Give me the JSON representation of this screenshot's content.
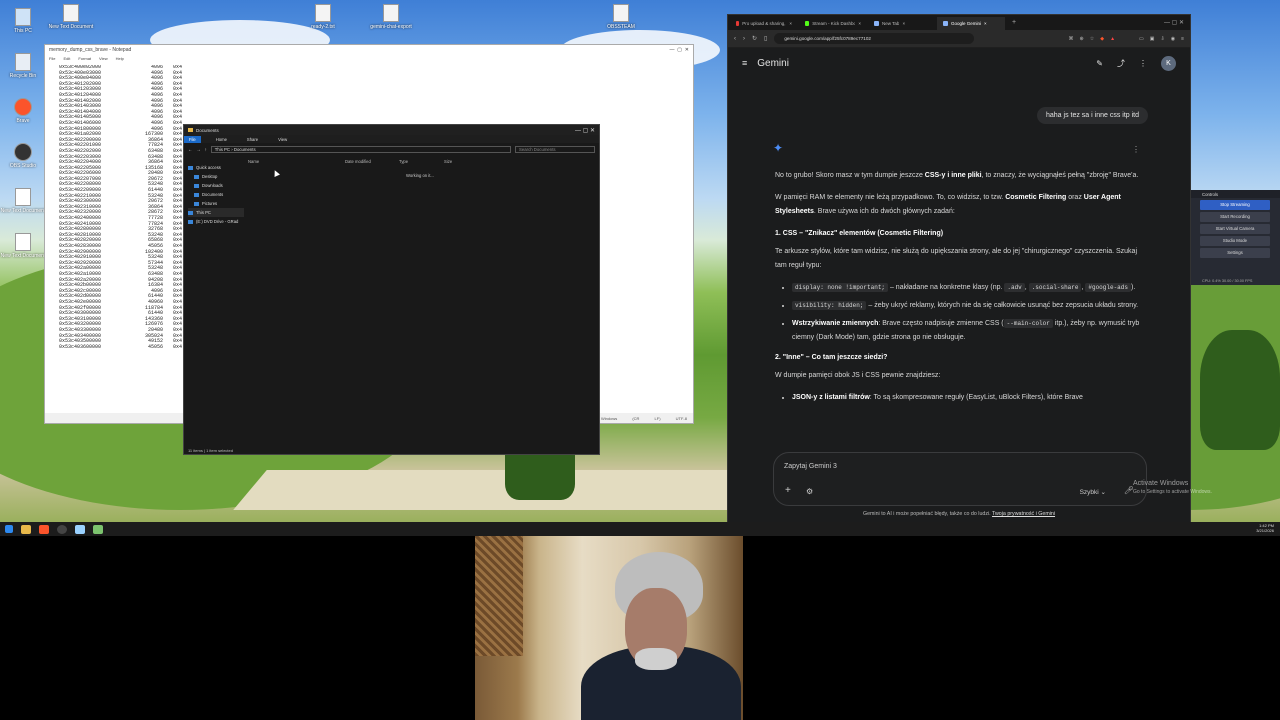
{
  "desktop": {
    "icons": [
      {
        "label": "This PC",
        "kind": "pc"
      },
      {
        "label": "Recycle Bin",
        "kind": "bin"
      },
      {
        "label": "Brave",
        "kind": "brave"
      },
      {
        "label": "OBS Studio",
        "kind": "obs"
      },
      {
        "label": "New Text Document",
        "kind": "doc"
      },
      {
        "label": "New Text Document",
        "kind": "doc"
      }
    ],
    "top_icons": [
      {
        "label": "New Text Document"
      },
      {
        "label": "ready-2.txt"
      },
      {
        "label": "gemini-chat-export"
      },
      {
        "label": "OBSSTEAM"
      }
    ]
  },
  "notepad": {
    "title": "memory_dump_css_brave - Notepad",
    "menu": [
      "File",
      "Edit",
      "Format",
      "View",
      "Help"
    ],
    "status": "Windows (CR LF)  UTF-8",
    "rows": [
      [
        "0x53c400e02000",
        "4096",
        "0x4"
      ],
      [
        "0x53c400e03000",
        "4096",
        "0x4"
      ],
      [
        "0x53c400e04000",
        "4096",
        "0x4"
      ],
      [
        "0x53c401202000",
        "4096",
        "0x4"
      ],
      [
        "0x53c401203000",
        "4096",
        "0x4"
      ],
      [
        "0x53c401204000",
        "4096",
        "0x4"
      ],
      [
        "0x53c401402000",
        "4096",
        "0x4"
      ],
      [
        "0x53c401403000",
        "4096",
        "0x4"
      ],
      [
        "0x53c401404000",
        "4096",
        "0x4"
      ],
      [
        "0x53c401405000",
        "4096",
        "0x4"
      ],
      [
        "0x53c401406000",
        "4096",
        "0x4"
      ],
      [
        "0x53c401800000",
        "4096",
        "0x4"
      ],
      [
        "0x53c401a02000",
        "167300",
        "0x4"
      ],
      [
        "0x53c402200000",
        "36864",
        "0x4"
      ],
      [
        "0x53c402201000",
        "77824",
        "0x4"
      ],
      [
        "0x53c402202000",
        "63488",
        "0x4"
      ],
      [
        "0x53c402203000",
        "63488",
        "0x4"
      ],
      [
        "0x53c402204000",
        "36864",
        "0x4"
      ],
      [
        "0x53c402205000",
        "135168",
        "0x4"
      ],
      [
        "0x53c402206000",
        "20480",
        "0x4"
      ],
      [
        "0x53c402207000",
        "20672",
        "0x4"
      ],
      [
        "0x53c402208000",
        "53248",
        "0x4"
      ],
      [
        "0x53c402209000",
        "61440",
        "0x4"
      ],
      [
        "0x53c402210000",
        "53248",
        "0x4"
      ],
      [
        "0x53c402300000",
        "20672",
        "0x4"
      ],
      [
        "0x53c402310000",
        "36864",
        "0x4"
      ],
      [
        "0x53c402320000",
        "28672",
        "0x4"
      ],
      [
        "0x53c402400000",
        "77728",
        "0x4"
      ],
      [
        "0x53c402410000",
        "77824",
        "0x4"
      ],
      [
        "0x53c402800000",
        "32768",
        "0x4"
      ],
      [
        "0x53c402810000",
        "53248",
        "0x4"
      ],
      [
        "0x53c402820000",
        "65868",
        "0x4"
      ],
      [
        "0x53c402830000",
        "45056",
        "0x4"
      ],
      [
        "0x53c402900000",
        "102400",
        "0x4"
      ],
      [
        "0x53c402910000",
        "53248",
        "0x4"
      ],
      [
        "0x53c402920000",
        "57344",
        "0x4"
      ],
      [
        "0x53c402a00000",
        "53248",
        "0x4"
      ],
      [
        "0x53c402a10000",
        "63488",
        "0x4"
      ],
      [
        "0x53c402a20000",
        "94208",
        "0x4"
      ],
      [
        "0x53c402b00000",
        "16384",
        "0x4"
      ],
      [
        "0x53c402c00000",
        "4096",
        "0x4"
      ],
      [
        "0x53c402d00000",
        "61440",
        "0x4"
      ],
      [
        "0x53c402e00000",
        "40960",
        "0x4"
      ],
      [
        "0x53c402f00000",
        "118784",
        "0x4"
      ],
      [
        "0x53c403000000",
        "61440",
        "0x4"
      ],
      [
        "0x53c403100000",
        "143360",
        "0x4"
      ],
      [
        "0x53c403200000",
        "126976",
        "0x4"
      ],
      [
        "0x53c403300000",
        "20480",
        "0x4"
      ],
      [
        "0x53c403400000",
        "305024",
        "0x4"
      ],
      [
        "0x53c403500000",
        "49152",
        "0x4"
      ],
      [
        "0x53c403600000",
        "45056",
        "0x4"
      ]
    ]
  },
  "explorer": {
    "title": "Documents",
    "ribbon": [
      "File",
      "Home",
      "Share",
      "View"
    ],
    "path": [
      "This PC",
      "Documents"
    ],
    "search_placeholder": "Search Documents",
    "nav": [
      "Quick access",
      "Desktop",
      "Downloads",
      "Documents",
      "Pictures",
      "This PC",
      "(E:) DVD Drive - GRad"
    ],
    "columns": [
      "Name",
      "Date modified",
      "Type",
      "Size"
    ],
    "working": "Working on it...",
    "status": "11 items  |  1 item selected"
  },
  "obs": {
    "header": "Controls",
    "buttons": [
      "Stop Streaming",
      "Start Recording",
      "Start Virtual Camera",
      "Studio Mode",
      "Settings"
    ],
    "footer": "CPU: 0.4%   30.00 / 30.00 FPS"
  },
  "taskbar": {
    "time": "1:42 PM",
    "date": "3/21/2026"
  },
  "browser": {
    "tabs": [
      {
        "label": "Pro upload & sharing, best orga...",
        "color": "#e53935"
      },
      {
        "label": "Stream - Kick Dashboard",
        "color": "#53fc18"
      },
      {
        "label": "New Tab",
        "color": "#8ab4f8"
      },
      {
        "label": "Google Gemini",
        "color": "#8ab4f8"
      }
    ],
    "url": "gemini.google.com/app/f25fc0789ec77102"
  },
  "gemini": {
    "title": "Gemini",
    "avatar": "K",
    "user_message": "haha js tez sa i inne css itp itd",
    "response": {
      "p1_pre": "No to grubo! Skoro masz w tym dumpie jeszcze ",
      "p1_bold": "CSS-y i inne pliki",
      "p1_post": ", to znaczy, że wyciągnąłeś pełną \"zbroję\" Brave'a.",
      "p2_pre": "W pamięci RAM te elementy nie leżą przypadkowo. To, co widzisz, to tzw. ",
      "p2_bold1": "Cosmetic Filtering",
      "p2_mid": " oraz ",
      "p2_bold2": "User Agent Stylesheets",
      "p2_post": ". Brave używa ich do dwóch głównych zadań:",
      "h1": "1. CSS – \"Znikacz\" elementów (Cosmetic Filtering)",
      "p3": "Te arkusze stylów, które tam widzisz, nie służą do upiększania strony, ale do jej \"chirurgicznego\" czyszczenia. Szukaj tam reguł typu:",
      "li1_code": "display: none !important;",
      "li1_text": " – nakładane na konkretne klasy (np. ",
      "li1_c2": ".adv",
      "li1_sep": ", ",
      "li1_c3": ".social-share",
      "li1_sep2": ", ",
      "li1_c4": "#google-ads",
      "li1_end": ").",
      "li2_code": "visibility: hidden;",
      "li2_text": " – żeby ukryć reklamy, których nie da się całkowicie usunąć bez zepsucia układu strony.",
      "li3_bold": "Wstrzykiwanie zmiennych",
      "li3_pre": ": Brave często nadpisuje zmienne CSS (",
      "li3_code": "--main-color",
      "li3_post": " itp.), żeby np. wymusić tryb ciemny (Dark Mode) tam, gdzie strona go nie obsługuje.",
      "h2": "2. \"Inne\" – Co tam jeszcze siedzi?",
      "p4": "W dumpie pamięci obok JS i CSS pewnie znajdziesz:",
      "li4_bold": "JSON-y z listami filtrów",
      "li4_text": ": To są skompresowane reguły (EasyList, uBlock Filters), które Brave"
    },
    "input_placeholder": "Zapytaj Gemini 3",
    "mode": "Szybki",
    "disclaimer": "Gemini to AI i może popełniać błędy, także co do ludzi.",
    "disclaimer_link": "Twoja prywatność i Gemini"
  },
  "activate": {
    "title": "Activate Windows",
    "sub": "Go to Settings to activate Windows."
  }
}
